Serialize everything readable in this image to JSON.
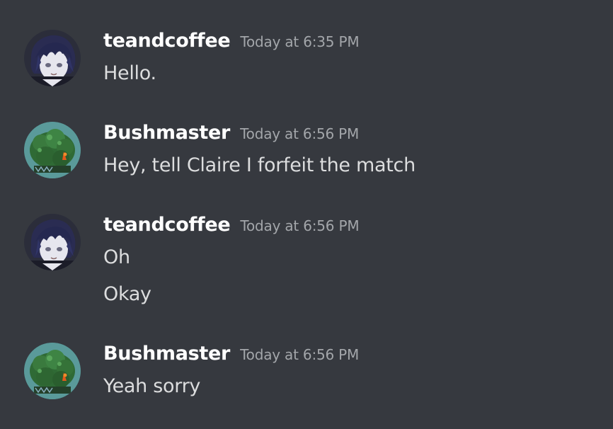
{
  "messages": [
    {
      "author": "teandcoffee",
      "avatar_icon": "anime-character-avatar-icon",
      "timestamp": "Today at 6:35 PM",
      "lines": [
        "Hello."
      ]
    },
    {
      "author": "Bushmaster",
      "avatar_icon": "bush-avatar-icon",
      "timestamp": "Today at 6:56 PM",
      "lines": [
        "Hey, tell Claire I forfeit the match"
      ]
    },
    {
      "author": "teandcoffee",
      "avatar_icon": "anime-character-avatar-icon",
      "timestamp": "Today at 6:56 PM",
      "lines": [
        "Oh",
        "Okay"
      ]
    },
    {
      "author": "Bushmaster",
      "avatar_icon": "bush-avatar-icon",
      "timestamp": "Today at 6:56 PM",
      "lines": [
        "Yeah sorry"
      ]
    }
  ],
  "colors": {
    "background": "#36393f",
    "username": "#ffffff",
    "timestamp": "#a3a6aa",
    "message_text": "#dcddde"
  }
}
